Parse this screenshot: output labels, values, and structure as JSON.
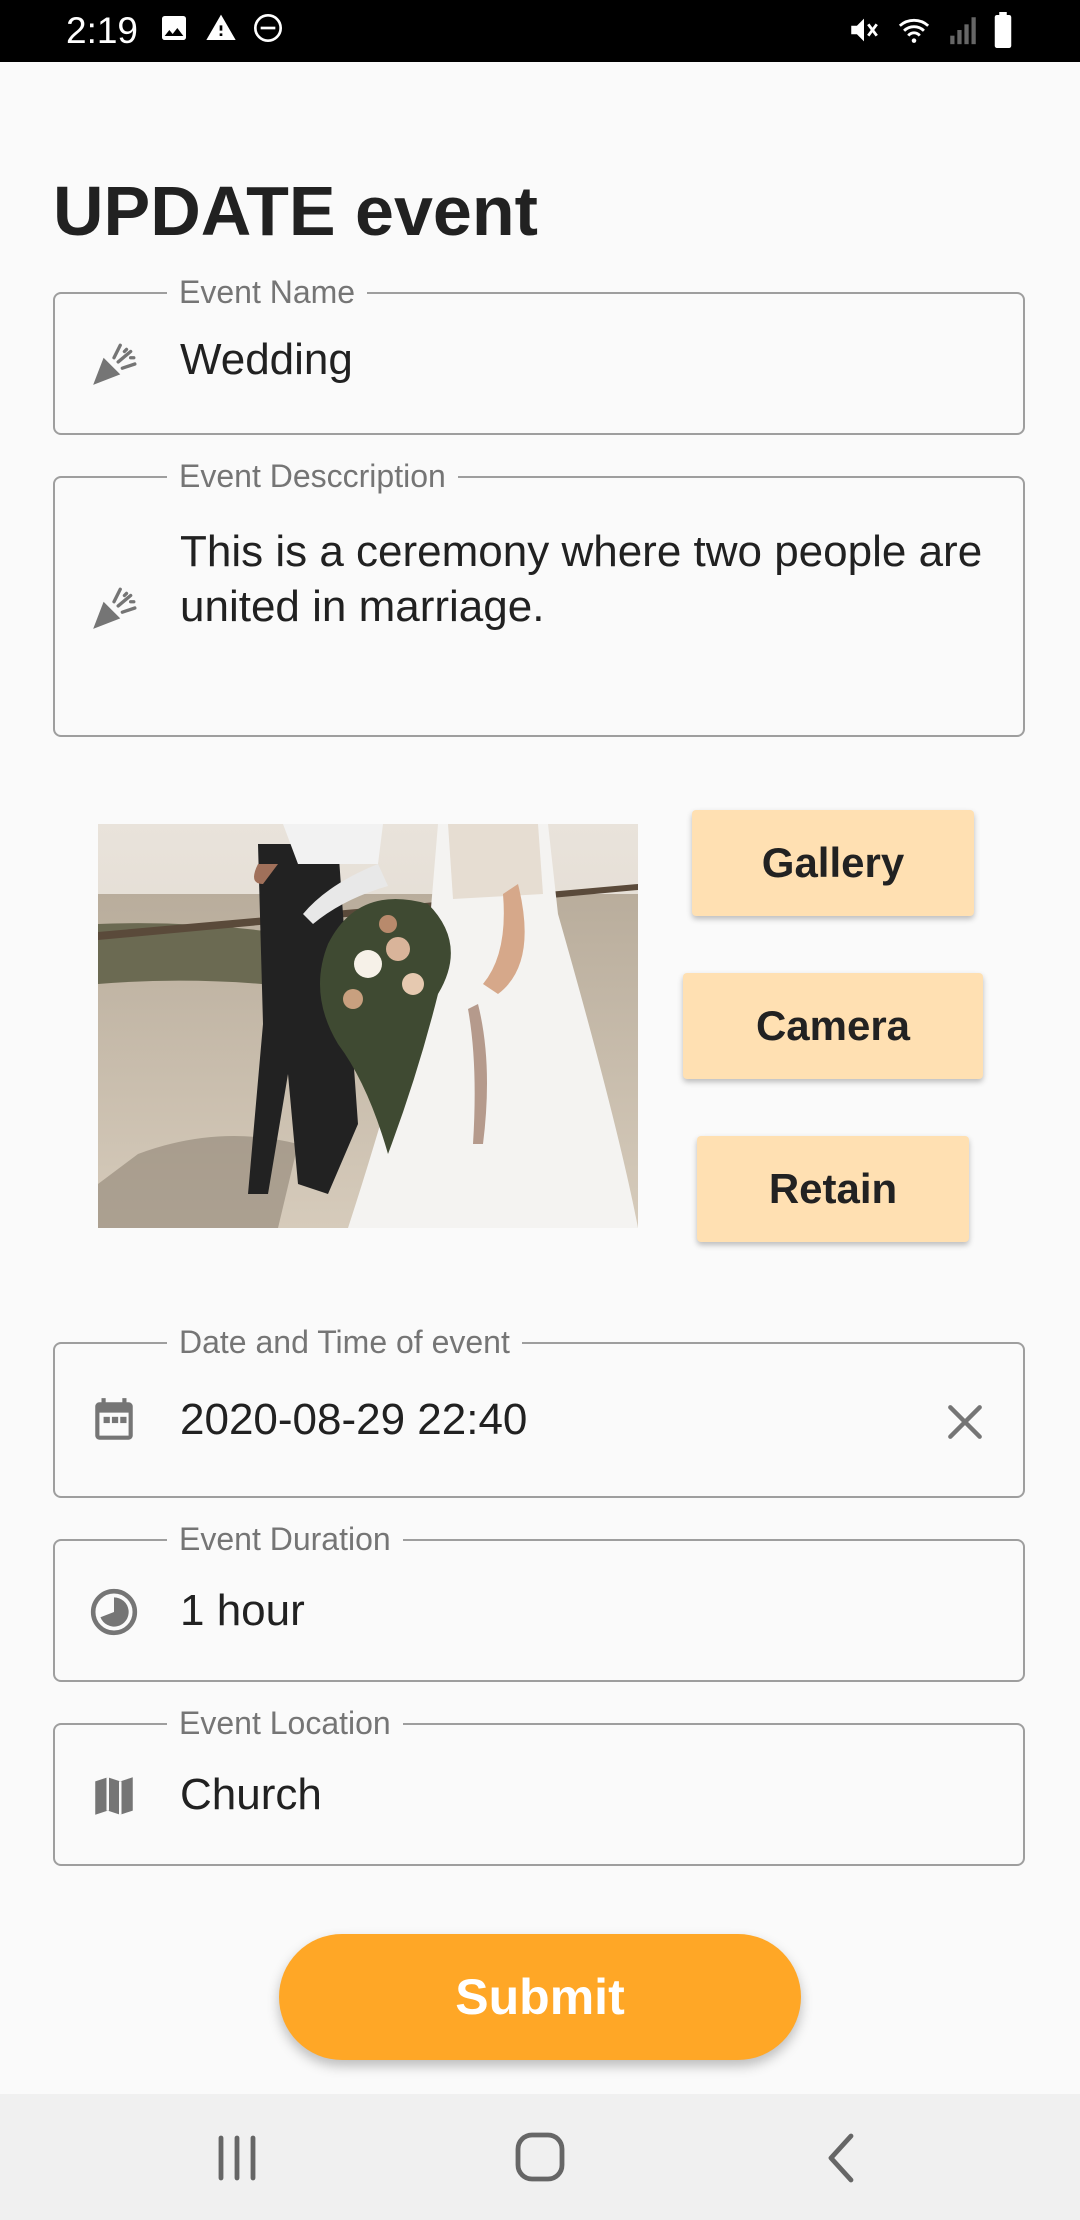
{
  "status_bar": {
    "time": "2:19",
    "icons": [
      "image-icon",
      "warning-icon",
      "do-not-disturb-icon",
      "mute-icon",
      "wifi-icon",
      "signal-icon",
      "battery-icon"
    ]
  },
  "page": {
    "title": "UPDATE event"
  },
  "form": {
    "event_name": {
      "label": "Event Name",
      "value": "Wedding",
      "icon": "party-popper-icon"
    },
    "event_description": {
      "label": "Event Desccription",
      "value": "This is a ceremony where two people are united in marriage.",
      "icon": "party-popper-icon"
    },
    "date_time": {
      "label": "Date and Time of event",
      "value": "2020-08-29 22:40",
      "icon": "calendar-icon",
      "clear_icon": "close-icon"
    },
    "duration": {
      "label": "Event Duration",
      "value": "1 hour",
      "icon": "clock-icon"
    },
    "location": {
      "label": "Event Location",
      "value": "Church",
      "icon": "map-icon"
    }
  },
  "photo_buttons": {
    "gallery": "Gallery",
    "camera": "Camera",
    "retain": "Retain"
  },
  "submit": {
    "label": "Submit"
  },
  "colors": {
    "accent": "#ffa726",
    "photo_button_bg": "#ffe0b2",
    "border": "#9e9e9e",
    "label": "#757575"
  },
  "nav_bar": {
    "icons": [
      "recents-icon",
      "home-icon",
      "back-icon"
    ]
  }
}
